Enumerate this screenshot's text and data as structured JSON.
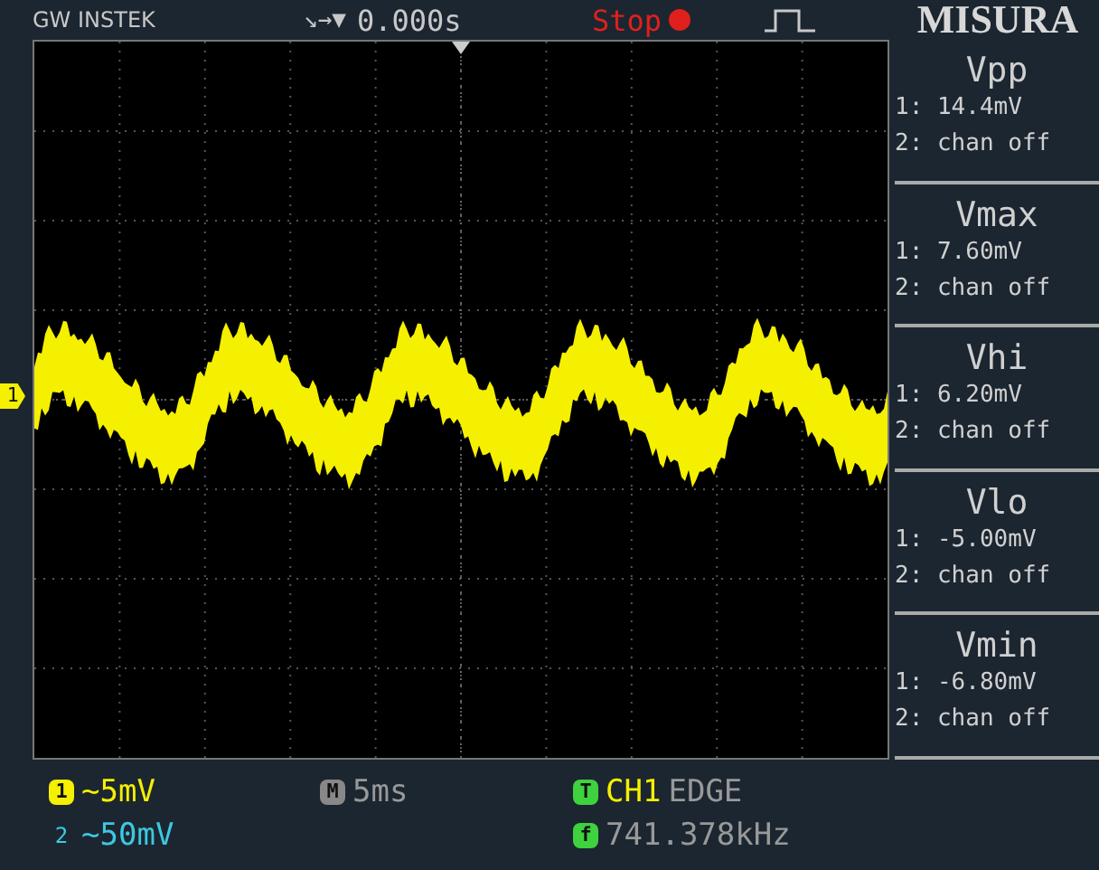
{
  "header": {
    "brand": "GW INSTEK",
    "trigger_status": "↘→▼",
    "time_offset": "0.000s",
    "run_state": "Stop",
    "title": "MISURA"
  },
  "measurements": [
    {
      "name": "Vpp",
      "ch1": "1: 14.4mV",
      "ch2": "2: chan off"
    },
    {
      "name": "Vmax",
      "ch1": "1: 7.60mV",
      "ch2": "2: chan off"
    },
    {
      "name": "Vhi",
      "ch1": "1: 6.20mV",
      "ch2": "2: chan off"
    },
    {
      "name": "Vlo",
      "ch1": "1: -5.00mV",
      "ch2": "2: chan off"
    },
    {
      "name": "Vmin",
      "ch1": "1: -6.80mV",
      "ch2": "2: chan off"
    }
  ],
  "channel_marker": "1",
  "footer": {
    "ch1_badge": "1",
    "ch1_scale": "~5mV",
    "ch2_badge": "2",
    "ch2_scale": "~50mV",
    "time_badge": "M",
    "timebase": "5ms",
    "trigger_badge": "T",
    "trigger_source": "CH1",
    "trigger_type": "EDGE",
    "freq_badge": "f",
    "frequency": "741.378kHz"
  }
}
